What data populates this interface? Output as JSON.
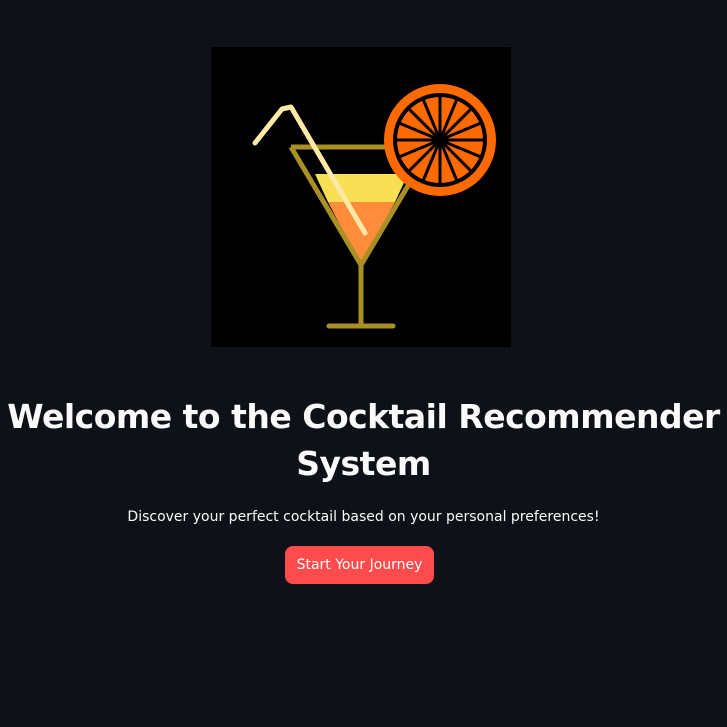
{
  "hero": {
    "logo_icon": "cocktail-glass-icon",
    "title": "Welcome to the Cocktail Recommender System",
    "subtitle": "Discover your perfect cocktail based on your personal preferences!",
    "cta_label": "Start Your Journey"
  },
  "colors": {
    "background": "#0e1117",
    "logo_background": "#000000",
    "glass": "#a89025",
    "straw": "#ffe9a6",
    "drink_top": "#f8df56",
    "drink_bottom": "#ff8c3a",
    "orange_slice": "#ff6a00",
    "button": "#ff4b4b",
    "text": "#fafafa"
  }
}
